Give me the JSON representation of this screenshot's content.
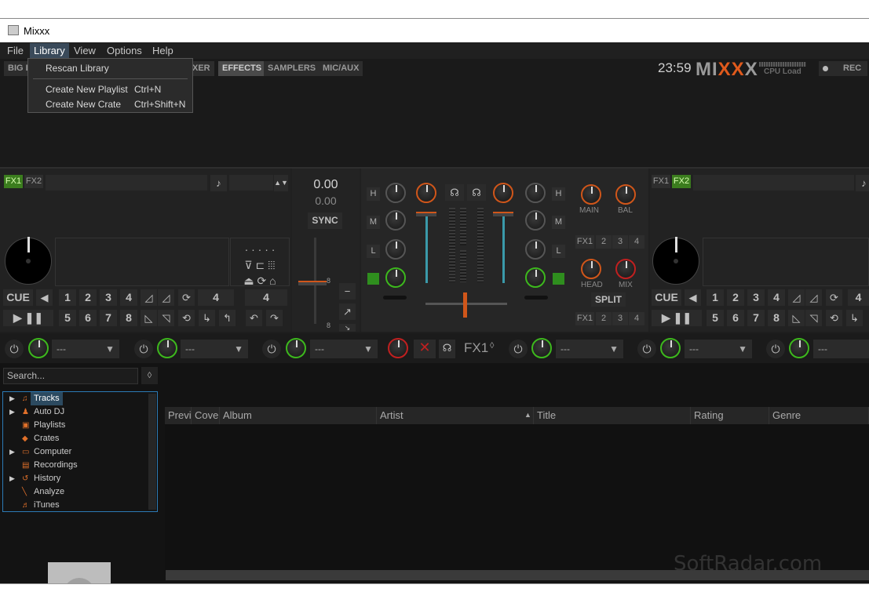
{
  "window": {
    "title": "Mixxx"
  },
  "menu": {
    "items": [
      "File",
      "Library",
      "View",
      "Options",
      "Help"
    ]
  },
  "library_menu": {
    "items": [
      {
        "label": "Rescan Library",
        "shortcut": ""
      },
      {
        "label": "Create New Playlist",
        "shortcut": "Ctrl+N"
      },
      {
        "label": "Create New Crate",
        "shortcut": "Ctrl+Shift+N"
      }
    ]
  },
  "toolbar": {
    "big_library": "BIG L",
    "mixer": "XER",
    "effects": "EFFECTS",
    "samplers": "SAMPLERS",
    "mic_aux": "MIC/AUX",
    "clock": "23:59",
    "logo": "MIXXX",
    "cpu_label": "CPU Load",
    "rec": "REC"
  },
  "deck1": {
    "fx1": "FX1",
    "fx2": "FX2",
    "cue": "CUE",
    "loop_size_a": "4",
    "loop_size_b": "4",
    "hotcues": [
      "1",
      "2",
      "3",
      "4",
      "5",
      "6",
      "7",
      "8"
    ]
  },
  "deck2": {
    "fx1": "FX1",
    "fx2": "FX2",
    "cue": "CUE",
    "loop_size_a": "4",
    "hotcues": [
      "1",
      "2",
      "3",
      "4",
      "5",
      "6",
      "7",
      "8"
    ]
  },
  "center": {
    "bpm": "0.00",
    "bpm_delta": "0.00",
    "sync": "SYNC",
    "rate_top": "8",
    "rate_bottom": "8"
  },
  "mixer": {
    "eq_high": "H",
    "eq_mid": "M",
    "eq_low": "L",
    "main": "MAIN",
    "bal": "BAL",
    "head": "HEAD",
    "mix": "MIX",
    "split": "SPLIT",
    "fx_units": [
      "FX1",
      "2",
      "3",
      "4"
    ],
    "fx_units2": [
      "FX1",
      "2",
      "3",
      "4"
    ]
  },
  "fxrow": {
    "selector": "---",
    "fx_label": "FX1"
  },
  "library": {
    "search_placeholder": "Search...",
    "tree": [
      {
        "label": "Tracks",
        "expandable": true,
        "selected": true
      },
      {
        "label": "Auto DJ",
        "expandable": true
      },
      {
        "label": "Playlists",
        "expandable": false
      },
      {
        "label": "Crates",
        "expandable": false
      },
      {
        "label": "Computer",
        "expandable": true
      },
      {
        "label": "Recordings",
        "expandable": false
      },
      {
        "label": "History",
        "expandable": true
      },
      {
        "label": "Analyze",
        "expandable": false
      },
      {
        "label": "iTunes",
        "expandable": false
      }
    ],
    "columns": [
      "Previ",
      "Cove",
      "Album",
      "Artist",
      "Title",
      "Rating",
      "Genre"
    ]
  },
  "watermark": "SoftRadar.com",
  "colors": {
    "accent_orange": "#d0561a",
    "accent_green": "#3db81d",
    "selection_blue": "#2c7ab5"
  }
}
